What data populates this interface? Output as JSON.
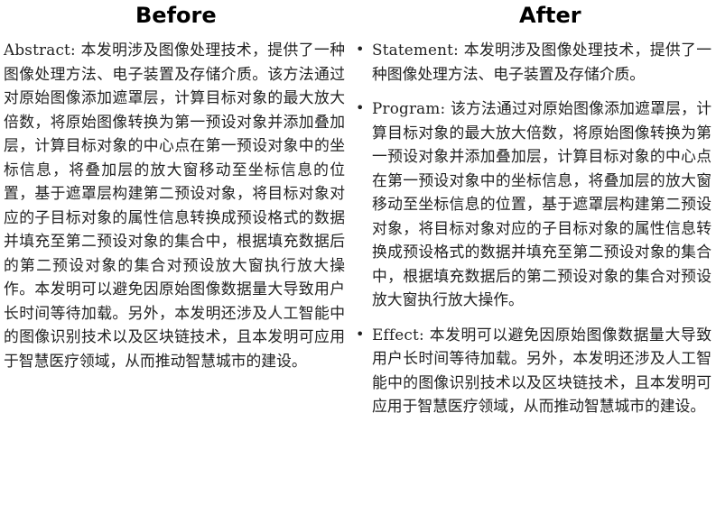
{
  "before": {
    "title": "Before",
    "label": "Abstract:",
    "text": "本发明涉及图像处理技术，提供了一种图像处理方法、电子装置及存储介质。该方法通过对原始图像添加遮罩层，计算目标对象的最大放大倍数，将原始图像转换为第一预设对象并添加叠加层，计算目标对象的中心点在第一预设对象中的坐标信息，将叠加层的放大窗移动至坐标信息的位置，基于遮罩层构建第二预设对象，将目标对象对应的子目标对象的属性信息转换成预设格式的数据并填充至第二预设对象的集合中，根据填充数据后的第二预设对象的集合对预设放大窗执行放大操作。本发明可以避免因原始图像数据量大导致用户长时间等待加载。另外，本发明还涉及人工智能中的图像识别技术以及区块链技术，且本发明可应用于智慧医疗领域，从而推动智慧城市的建设。"
  },
  "after": {
    "title": "After",
    "items": [
      {
        "bullet": "•",
        "label": "Statement:",
        "text": "本发明涉及图像处理技术，提供了一种图像处理方法、电子装置及存储介质。"
      },
      {
        "bullet": "•",
        "label": "Program:",
        "text": "该方法通过对原始图像添加遮罩层，计算目标对象的最大放大倍数，将原始图像转换为第一预设对象并添加叠加层，计算目标对象的中心点在第一预设对象中的坐标信息，将叠加层的放大窗移动至坐标信息的位置，基于遮罩层构建第二预设对象，将目标对象对应的子目标对象的属性信息转换成预设格式的数据并填充至第二预设对象的集合中，根据填充数据后的第二预设对象的集合对预设放大窗执行放大操作。"
      },
      {
        "bullet": "•",
        "label": "Effect:",
        "text": "本发明可以避免因原始图像数据量大导致用户长时间等待加载。另外，本发明还涉及人工智能中的图像识别技术以及区块链技术，且本发明可应用于智慧医疗领域，从而推动智慧城市的建设。"
      }
    ]
  }
}
